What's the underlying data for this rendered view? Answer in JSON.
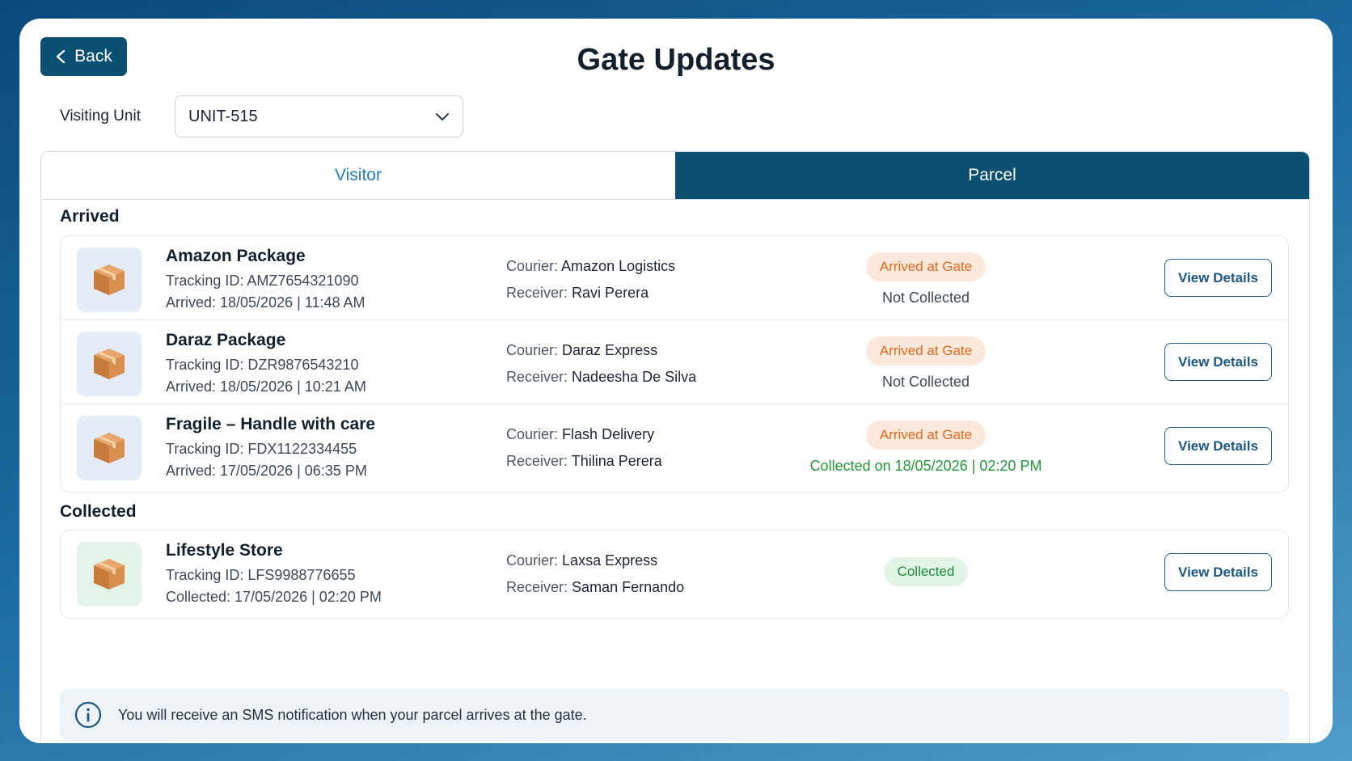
{
  "header": {
    "back_label": "Back",
    "title": "Gate Updates"
  },
  "unit": {
    "label": "Visiting Unit",
    "selected": "UNIT-515"
  },
  "tabs": [
    {
      "label": "Visitor",
      "active": false
    },
    {
      "label": "Parcel",
      "active": true
    }
  ],
  "labels": {
    "courier": "Courier:",
    "receiver": "Receiver:",
    "view_details": "View Details"
  },
  "arrived": {
    "title": "Arrived",
    "items": [
      {
        "name": "Amazon Package",
        "tracking": "Tracking ID: AMZ7654321090",
        "time": "Arrived: 18/05/2026 | 11:48 AM",
        "courier": "Amazon Logistics",
        "receiver": "Ravi Perera",
        "badge": "Arrived at Gate",
        "status": "Not Collected"
      },
      {
        "name": "Daraz Package",
        "tracking": "Tracking ID: DZR9876543210",
        "time": "Arrived: 18/05/2026 | 10:21 AM",
        "courier": "Daraz Express",
        "receiver": "Nadeesha De Silva",
        "badge": "Arrived at Gate",
        "status": "Not Collected"
      },
      {
        "name": "Fragile – Handle with care",
        "tracking": "Tracking ID: FDX1122334455",
        "time": "Arrived: 17/05/2026 | 06:35 PM",
        "courier": "Flash Delivery",
        "receiver": "Thilina Perera",
        "badge": "Arrived at Gate",
        "status": "Collected on 18/05/2026 | 02:20 PM"
      }
    ]
  },
  "collected": {
    "title": "Collected",
    "items": [
      {
        "name": "Lifestyle Store",
        "tracking": "Tracking ID: LFS9988776655",
        "time": "Collected: 17/05/2026 | 02:20 PM",
        "courier": "Laxsa Express",
        "receiver": "Saman Fernando",
        "badge": "Collected"
      }
    ]
  },
  "note": "You will receive an SMS notification when your parcel arrives at the gate.",
  "colors": {
    "primary": "#0b4f73",
    "accent_blue": "#1f7ac4",
    "arrived_badge": "#e3681f",
    "collected_green": "#1c8a3a"
  },
  "icons": {
    "back": "chevron-left-icon",
    "dropdown": "chevron-down-icon",
    "parcel": "package-box-icon",
    "info": "info-circle-icon"
  }
}
